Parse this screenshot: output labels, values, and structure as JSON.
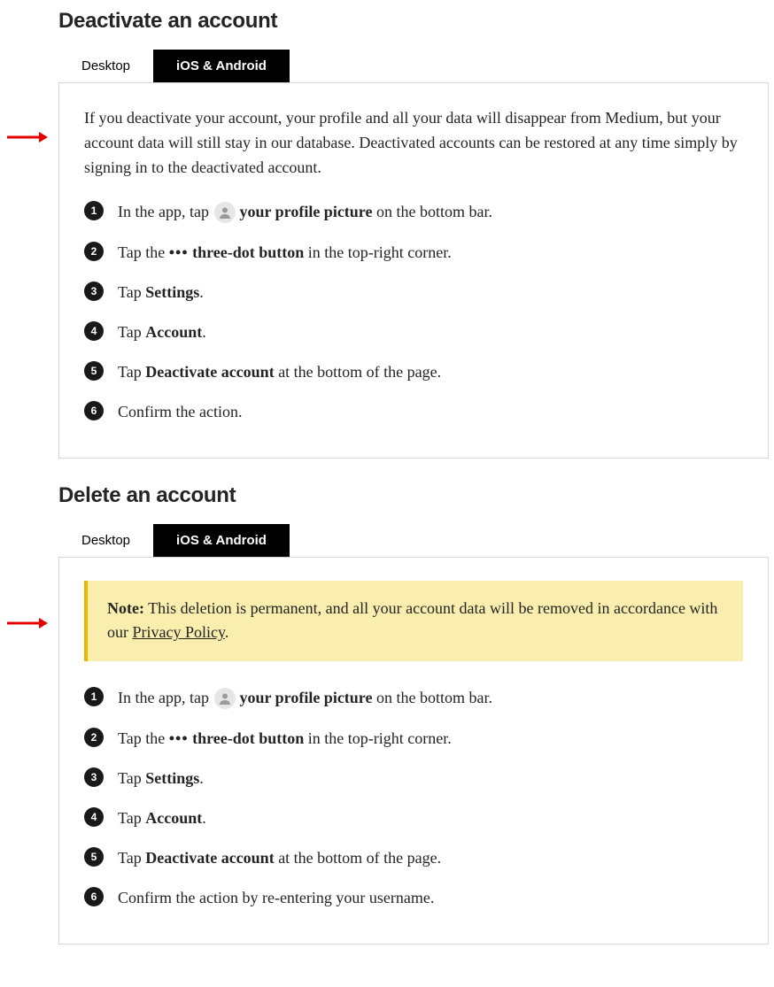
{
  "sections": [
    {
      "heading": "Deactivate an account",
      "tabs": {
        "inactive": "Desktop",
        "active": "iOS & Android"
      },
      "intro": "If you deactivate your account, your profile and all your data will disappear from Medium, but your account data will still stay in our database. Deactivated accounts can be restored at any time simply by signing in to the deactivated account.",
      "steps": [
        {
          "pre": "In the app, tap ",
          "icon": "profile",
          "bold": "your profile picture",
          "post": " on the bottom bar."
        },
        {
          "pre": "Tap the ",
          "icon": "dots",
          "bold": "three-dot button",
          "post": " in the top-right corner."
        },
        {
          "pre": "Tap ",
          "bold": "Settings",
          "post": "."
        },
        {
          "pre": "Tap ",
          "bold": "Account",
          "post": "."
        },
        {
          "pre": "Tap ",
          "bold": "Deactivate account",
          "post": " at the bottom of the page."
        },
        {
          "plain": "Confirm the action."
        }
      ]
    },
    {
      "heading": "Delete an account",
      "tabs": {
        "inactive": "Desktop",
        "active": "iOS & Android"
      },
      "note": {
        "label": "Note:",
        "pre": " This deletion is permanent, and all your account data will be removed in accordance with our ",
        "link": "Privacy Policy",
        "post": "."
      },
      "steps": [
        {
          "pre": "In the app, tap ",
          "icon": "profile",
          "bold": "your profile picture",
          "post": " on the bottom bar."
        },
        {
          "pre": "Tap the ",
          "icon": "dots",
          "bold": "three-dot button",
          "post": " in the top-right corner."
        },
        {
          "pre": "Tap ",
          "bold": "Settings",
          "post": "."
        },
        {
          "pre": "Tap ",
          "bold": "Account",
          "post": "."
        },
        {
          "pre": "Tap ",
          "bold": "Deactivate account",
          "post": " at the bottom of the page."
        },
        {
          "plain": "Confirm the action by re-entering your username."
        }
      ]
    }
  ],
  "icons": {
    "dots": "•••"
  }
}
